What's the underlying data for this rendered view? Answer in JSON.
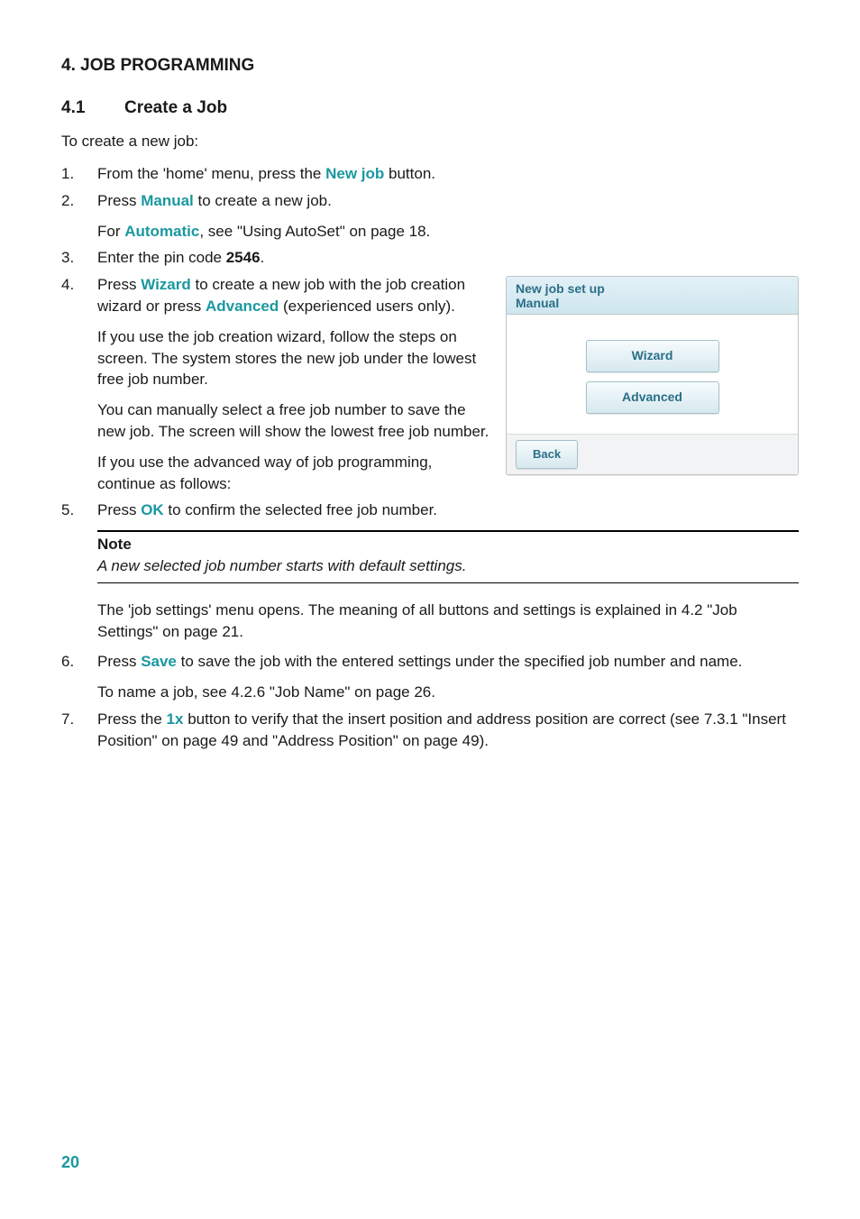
{
  "heading1": "4.   JOB PROGRAMMING",
  "heading2_num": "4.1",
  "heading2_text": "Create a Job",
  "intro": "To create a new job:",
  "steps": {
    "n1": "1.",
    "s1_a": "From the 'home' menu, press the ",
    "s1_hl": "New job",
    "s1_b": " button.",
    "n2": "2.",
    "s2_a": "Press ",
    "s2_hl": "Manual",
    "s2_b": " to create a new job.",
    "s2_c": "For ",
    "s2_hl2": "Automatic",
    "s2_d": ", see \"Using AutoSet\" on page 18.",
    "n3": "3.",
    "s3_a": "Enter the pin code ",
    "s3_bold": "2546",
    "s3_b": ".",
    "n4": "4.",
    "s4_a": "Press ",
    "s4_hl1": "Wizard",
    "s4_b": " to create a new job with the job creation wizard or press ",
    "s4_hl2": "Advanced",
    "s4_c": " (experienced users only).",
    "s4_p2": "If you use the job creation wizard, follow the steps on screen. The system stores the new job under the lowest free job number.",
    "s4_p3": "You can manually select a free job number to save the new job. The screen will show the lowest free job number.",
    "s4_p4": "If you use the advanced way of job programming, continue as follows:",
    "n5": "5.",
    "s5_a": "Press ",
    "s5_hl": "OK",
    "s5_b": " to confirm the selected free job number.",
    "s5_after1": "The 'job settings' menu opens. The meaning of all buttons and settings is explained in 4.2 \"Job Settings\" on page 21.",
    "n6": "6.",
    "s6_a": "Press ",
    "s6_hl": "Save",
    "s6_b": " to save the job with the entered settings under the specified job number and name.",
    "s6_p2": "To name a job, see 4.2.6 \"Job Name\" on page 26.",
    "n7": "7.",
    "s7_a": "Press the ",
    "s7_hl": "1x",
    "s7_b": " button to verify that the insert position and address position are correct (see 7.3.1 \"Insert Position\" on page 49 and \"Address Position\" on page 49)."
  },
  "note": {
    "label": "Note",
    "body": "A new selected job number starts with default settings."
  },
  "screenshot": {
    "title1": "New job set up",
    "title2": "Manual",
    "wizard": "Wizard",
    "advanced": "Advanced",
    "back": "Back"
  },
  "page_number": "20"
}
